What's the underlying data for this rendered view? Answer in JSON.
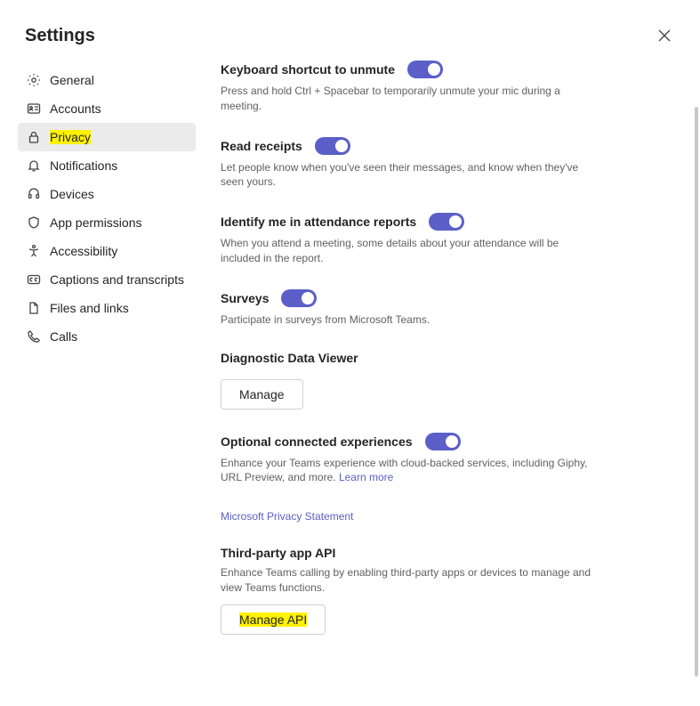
{
  "header": {
    "title": "Settings"
  },
  "sidebar": {
    "items": [
      {
        "label": "General"
      },
      {
        "label": "Accounts"
      },
      {
        "label": "Privacy",
        "selected": true,
        "highlight": true
      },
      {
        "label": "Notifications"
      },
      {
        "label": "Devices"
      },
      {
        "label": "App permissions"
      },
      {
        "label": "Accessibility"
      },
      {
        "label": "Captions and transcripts"
      },
      {
        "label": "Files and links"
      },
      {
        "label": "Calls"
      }
    ]
  },
  "sections": {
    "unmute": {
      "title": "Keyboard shortcut to unmute",
      "desc": "Press and hold Ctrl + Spacebar to temporarily unmute your mic during a meeting.",
      "toggle": true
    },
    "receipts": {
      "title": "Read receipts",
      "desc": "Let people know when you've seen their messages, and know when they've seen yours.",
      "toggle": true
    },
    "attendance": {
      "title": "Identify me in attendance reports",
      "desc": "When you attend a meeting, some details about your attendance will be included in the report.",
      "toggle": true
    },
    "surveys": {
      "title": "Surveys",
      "desc": "Participate in surveys from Microsoft Teams.",
      "toggle": true
    },
    "diag": {
      "title": "Diagnostic Data Viewer",
      "button": "Manage"
    },
    "optional": {
      "title": "Optional connected experiences",
      "desc": "Enhance your Teams experience with cloud-backed services, including Giphy, URL Preview, and more. ",
      "link": "Learn more",
      "toggle": true
    },
    "privacy_link": "Microsoft Privacy Statement",
    "third": {
      "title": "Third-party app API",
      "desc": "Enhance Teams calling by enabling third-party apps or devices to manage and view Teams functions.",
      "button": "Manage API",
      "highlight": true
    }
  }
}
